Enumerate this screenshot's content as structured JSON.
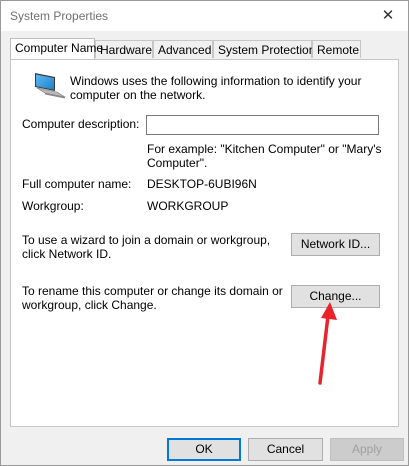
{
  "window": {
    "title": "System Properties",
    "close_glyph": "✕"
  },
  "tabs": [
    {
      "label": "Computer Name",
      "active": true
    },
    {
      "label": "Hardware",
      "active": false
    },
    {
      "label": "Advanced",
      "active": false
    },
    {
      "label": "System Protection",
      "active": false
    },
    {
      "label": "Remote",
      "active": false
    }
  ],
  "computer_name": {
    "intro": "Windows uses the following information to identify your computer on the network.",
    "description_label": "Computer description:",
    "description_value": "",
    "description_example": "For example: \"Kitchen Computer\" or \"Mary's Computer\".",
    "full_name_label": "Full computer name:",
    "full_name_value": "DESKTOP-6UBI96N",
    "workgroup_label": "Workgroup:",
    "workgroup_value": "WORKGROUP",
    "network_id_text": "To use a wizard to join a domain or workgroup, click Network ID.",
    "network_id_button": "Network ID...",
    "rename_text": "To rename this computer or change its domain or workgroup, click Change.",
    "change_button": "Change..."
  },
  "footer": {
    "ok": "OK",
    "cancel": "Cancel",
    "apply": "Apply"
  },
  "colors": {
    "annotation_arrow": "#e8232b",
    "focus_border": "#0078d7"
  },
  "icons": {
    "computer": "computer-icon",
    "close": "close-icon"
  }
}
